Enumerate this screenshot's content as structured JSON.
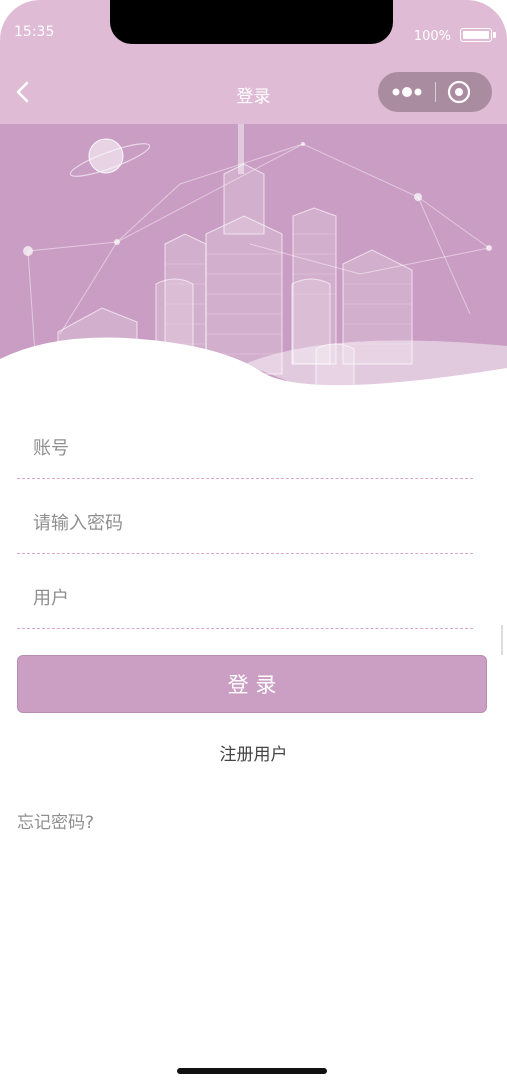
{
  "status_bar": {
    "time": "15:35",
    "battery": "100%"
  },
  "navbar": {
    "title": "登录"
  },
  "form": {
    "account_placeholder": "账号",
    "password_placeholder": "请输入密码",
    "user_placeholder": "用户"
  },
  "actions": {
    "login_label": "登 录",
    "register_label": "注册用户",
    "forgot_label": "忘记密码?"
  },
  "colors": {
    "accent": "#cb9fc3",
    "navbar": "#dfbbd6",
    "banner": "#ca9ec4"
  }
}
